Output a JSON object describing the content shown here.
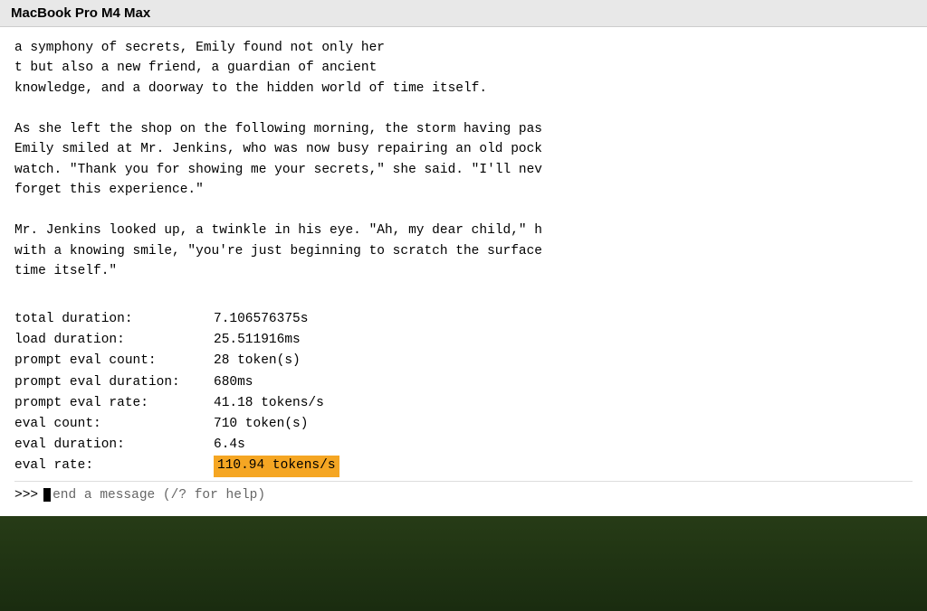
{
  "titleBar": {
    "title": "MacBook Pro M4 Max"
  },
  "terminal": {
    "paragraphs": [
      "a symphony of secrets, Emily found not only her\nt but also a new friend, a guardian of ancient\nknowledge, and a doorway to the hidden world of time itself.",
      "As she left the shop on the following morning, the storm having pas\nEmily smiled at Mr. Jenkins, who was now busy repairing an old pock\nwatch. \"Thank you for showing me your secrets,\" she said. \"I'll nev\nforget this experience.\"",
      "Mr. Jenkins looked up, a twinkle in his eye. \"Ah, my dear child,\" h\nwith a knowing smile, \"you're just beginning to scratch the surface\ntime itself.\""
    ],
    "stats": [
      {
        "label": "total duration:",
        "value": "7.106576375s",
        "highlighted": false
      },
      {
        "label": "load duration:",
        "value": "25.511916ms",
        "highlighted": false
      },
      {
        "label": "prompt eval count:",
        "value": "28 token(s)",
        "highlighted": false
      },
      {
        "label": "prompt eval duration:",
        "value": "680ms",
        "highlighted": false
      },
      {
        "label": "prompt eval rate:",
        "value": "41.18 tokens/s",
        "highlighted": false
      },
      {
        "label": "eval count:",
        "value": "710 token(s)",
        "highlighted": false
      },
      {
        "label": "eval duration:",
        "value": "6.4s",
        "highlighted": false
      },
      {
        "label": "eval rate:",
        "value": "110.94 tokens/s",
        "highlighted": true
      }
    ],
    "prompt": {
      "symbol": ">>>",
      "placeholder": "end a message (/? for help)"
    }
  }
}
